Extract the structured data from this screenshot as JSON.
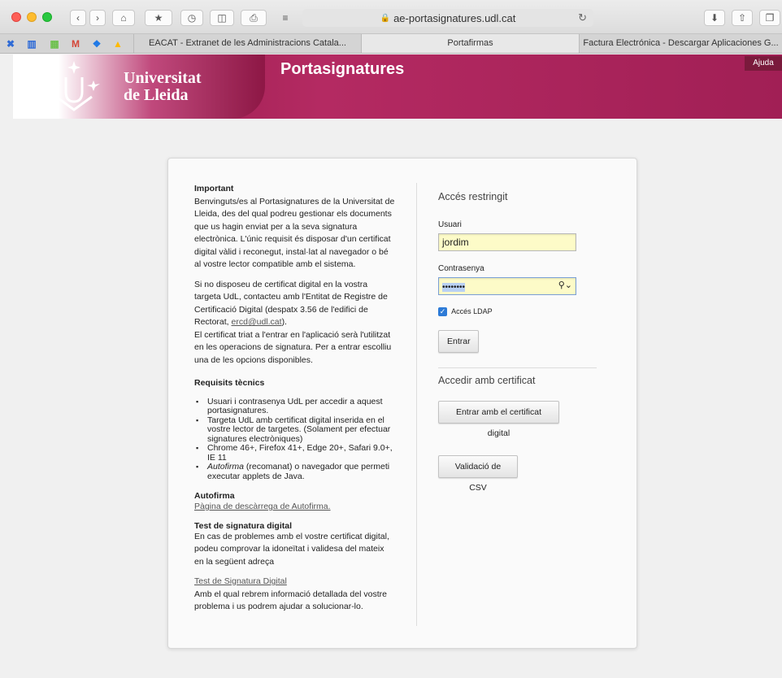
{
  "browser": {
    "url": "ae-portasignatures.udl.cat",
    "tabs": [
      {
        "label": "EACAT - Extranet de les Administracions Catala..."
      },
      {
        "label": "Portafirmas"
      },
      {
        "label": "Factura Electrónica - Descargar Aplicaciones G..."
      }
    ]
  },
  "header": {
    "logo_line1": "Universitat",
    "logo_line2": "de Lleida",
    "title": "Portasignatures",
    "help": "Ajuda"
  },
  "info": {
    "important_title": "Important",
    "intro": "Benvinguts/es al Portasignatures de la Universitat de Lleida, des del qual podreu gestionar els documents que us hagin enviat per a la seva signatura electrònica. L'únic requisit és disposar d'un certificat digital vàlid i reconegut, instal·lat al navegador o bé al vostre lector compatible amb el sistema.",
    "no_cert_text": "Si no disposeu de certificat digital en la vostra targeta UdL, contacteu amb l'Entitat de Registre de Certificació Digital (despatx 3.56 de l'edifici de Rectorat, ",
    "email": "ercd@udl.cat",
    "no_cert_end": ").",
    "cert_text": "El certificat triat a l'entrar en l'aplicació serà l'utilitzat en les operacions de signatura. Per a entrar escolliu una de les opcions disponibles.",
    "req_title": "Requisits tècnics",
    "requirements": [
      "Usuari i contrasenya UdL per accedir a aquest portasignatures.",
      "Targeta UdL amb certificat digital inserida en el vostre lector de targetes. (Solament per efectuar signatures electròniques)",
      "Chrome 46+, Firefox 41+, Edge 20+, Safari 9.0+, IE 11"
    ],
    "req4_em": "Autofirma",
    "req4_rest": " (recomanat) o navegador que permeti executar applets de Java.",
    "autofirma_title": "Autofirma",
    "autofirma_link": "Pàgina de descàrrega de Autofirma.",
    "test_title": "Test de signatura digital",
    "test_text": "En cas de problemes amb el vostre certificat digital, podeu comprovar la idoneïtat i validesa del mateix en la següent adreça",
    "test_link": "Test de Signatura Digital",
    "test_after": "Amb el qual rebrem informació detallada del vostre problema i us podrem ajudar a solucionar-lo."
  },
  "login": {
    "title": "Accés restringit",
    "user_label": "Usuari",
    "user_value": "jordim",
    "password_label": "Contrasenya",
    "password_value": "••••••••",
    "ldap_label": "Accés LDAP",
    "ldap_checked": true,
    "submit": "Entrar"
  },
  "cert": {
    "title": "Accedir amb certificat",
    "cert_button": "Entrar amb el certificat digital",
    "csv_button": "Validació de CSV"
  }
}
